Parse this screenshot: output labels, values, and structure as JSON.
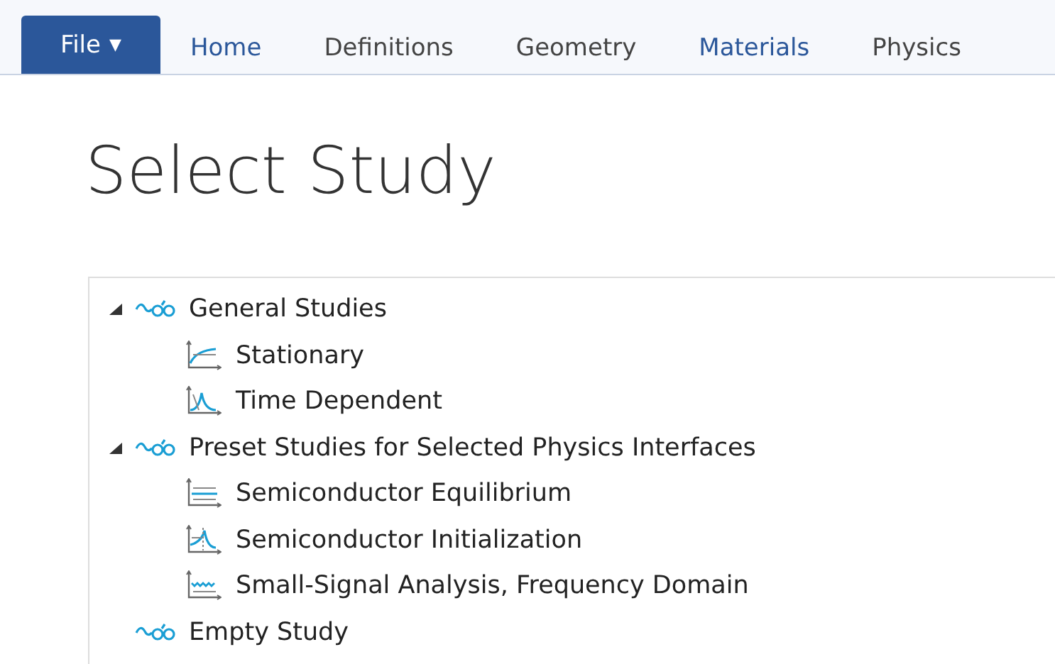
{
  "ribbon": {
    "file_button": "File",
    "file_caret": "▼",
    "tabs": [
      {
        "label": "Home",
        "highlighted": true
      },
      {
        "label": "Definitions",
        "highlighted": false
      },
      {
        "label": "Geometry",
        "highlighted": false
      },
      {
        "label": "Materials",
        "highlighted": true
      },
      {
        "label": "Physics",
        "highlighted": false
      }
    ]
  },
  "page": {
    "title": "Select Study"
  },
  "tree": [
    {
      "label": "General Studies",
      "kind": "group",
      "expanded": true,
      "children": [
        {
          "label": "Stationary",
          "kind": "stationary"
        },
        {
          "label": "Time Dependent",
          "kind": "time-dependent"
        }
      ]
    },
    {
      "label": "Preset Studies for Selected Physics Interfaces",
      "kind": "group",
      "expanded": true,
      "children": [
        {
          "label": "Semiconductor Equilibrium",
          "kind": "equilibrium"
        },
        {
          "label": "Semiconductor Initialization",
          "kind": "initialization"
        },
        {
          "label": "Small-Signal Analysis, Frequency Domain",
          "kind": "frequency"
        }
      ]
    },
    {
      "label": "Empty Study",
      "kind": "group"
    }
  ]
}
